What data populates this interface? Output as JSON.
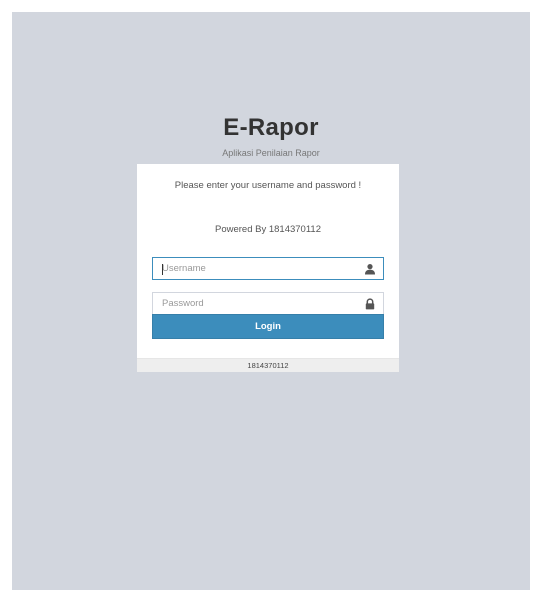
{
  "brand": {
    "title": "E-Rapor",
    "subtitle": "Aplikasi Penilaian Rapor"
  },
  "login": {
    "message": "Please enter your username and password !",
    "powered_by": "Powered By 1814370112",
    "username": {
      "value": "",
      "placeholder": "Username",
      "icon": "user-icon"
    },
    "password": {
      "value": "",
      "placeholder": "Password",
      "icon": "lock-icon"
    },
    "submit_label": "Login"
  },
  "footer": {
    "text": "1814370112"
  },
  "colors": {
    "background": "#d2d6de",
    "primary": "#3c8dbc",
    "box": "#ffffff"
  }
}
